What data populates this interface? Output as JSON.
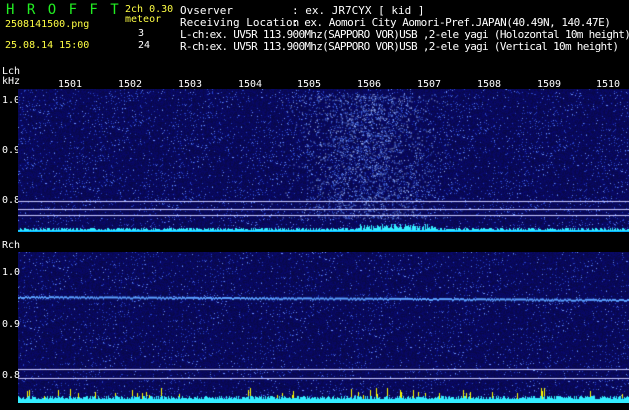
{
  "header": {
    "logo": "H R O F F T",
    "mode": "2ch 0.30",
    "meteor_label": "meteor",
    "file_name": "2508141500.png",
    "datetime": "25.08.14 15:00",
    "l_count": "3",
    "r_count": "24",
    "observer_label": "Ovserver",
    "observer_value": ": ex. JR7CYX [ kid ]",
    "location_label": "Receiving Location",
    "location_value": ": ex. Aomori City Aomori-Pref.JAPAN(40.49N, 140.47E)",
    "lch_info": "L-ch:ex. UV5R 113.900Mhz(SAPPORO VOR)USB ,2-ele yagi (Holozontal 10m height)",
    "rch_info": "R-ch:ex. UV5R 113.900Mhz(SAPPORO VOR)USB ,2-ele yagi (Vertical 10m height)"
  },
  "lch": {
    "label": "Lch",
    "unit": "kHz",
    "y_ticks": [
      "1.0",
      "0.9",
      "0.8"
    ]
  },
  "rch": {
    "label": "Rch",
    "y_ticks": [
      "1.0",
      "0.9",
      "0.8"
    ]
  },
  "time_axis": {
    "ticks": [
      "1501",
      "1502",
      "1503",
      "1504",
      "1505",
      "1506",
      "1507",
      "1508",
      "1509",
      "1510"
    ]
  },
  "colors": {
    "background": "#000000",
    "spectrogram": "#0a0a6e",
    "signal": "#5aa0ff",
    "baseline": "#33eeff",
    "burst": "#ffff00",
    "grid": "#c8c8ff",
    "header_text": "#ffffff",
    "accent_text": "#22ee22",
    "meteor_text": "#ffff44"
  }
}
